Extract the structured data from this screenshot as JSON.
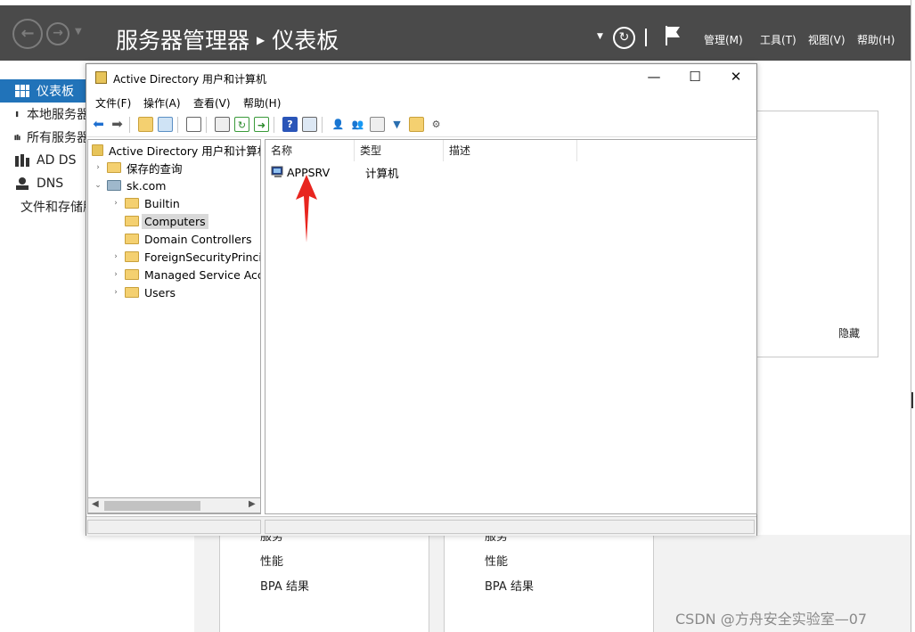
{
  "server_manager": {
    "breadcrumb_app": "服务器管理器",
    "breadcrumb_page": "仪表板",
    "menu": [
      "管理(M)",
      "工具(T)",
      "视图(V)",
      "帮助(H)"
    ],
    "nav": [
      "仪表板",
      "本地服务器",
      "所有服务器",
      "AD DS",
      "DNS",
      "文件和存储服务"
    ],
    "welcome_hide": "隐藏",
    "tile1": [
      "服务",
      "性能",
      "BPA 结果"
    ],
    "tile2": [
      "服务",
      "性能",
      "BPA 结果"
    ],
    "watermark": "CSDN @方舟安全实验室—07"
  },
  "aduc": {
    "title": "Active Directory 用户和计算机",
    "menu": [
      "文件(F)",
      "操作(A)",
      "查看(V)",
      "帮助(H)"
    ],
    "tree": {
      "root": "Active Directory 用户和计算机",
      "saved_queries": "保存的查询",
      "domain": "sk.com",
      "children": [
        "Builtin",
        "Computers",
        "Domain Controllers",
        "ForeignSecurityPrincipals",
        "Managed Service Accounts",
        "Users"
      ],
      "selected": "Computers"
    },
    "columns": [
      "名称",
      "类型",
      "描述"
    ],
    "rows": [
      {
        "name": "APPSRV",
        "type": "计算机",
        "desc": ""
      }
    ]
  },
  "colors": {
    "topbar": "#4a4a4a",
    "nav_selected": "#2173b9",
    "annotation": "#e8251f"
  }
}
